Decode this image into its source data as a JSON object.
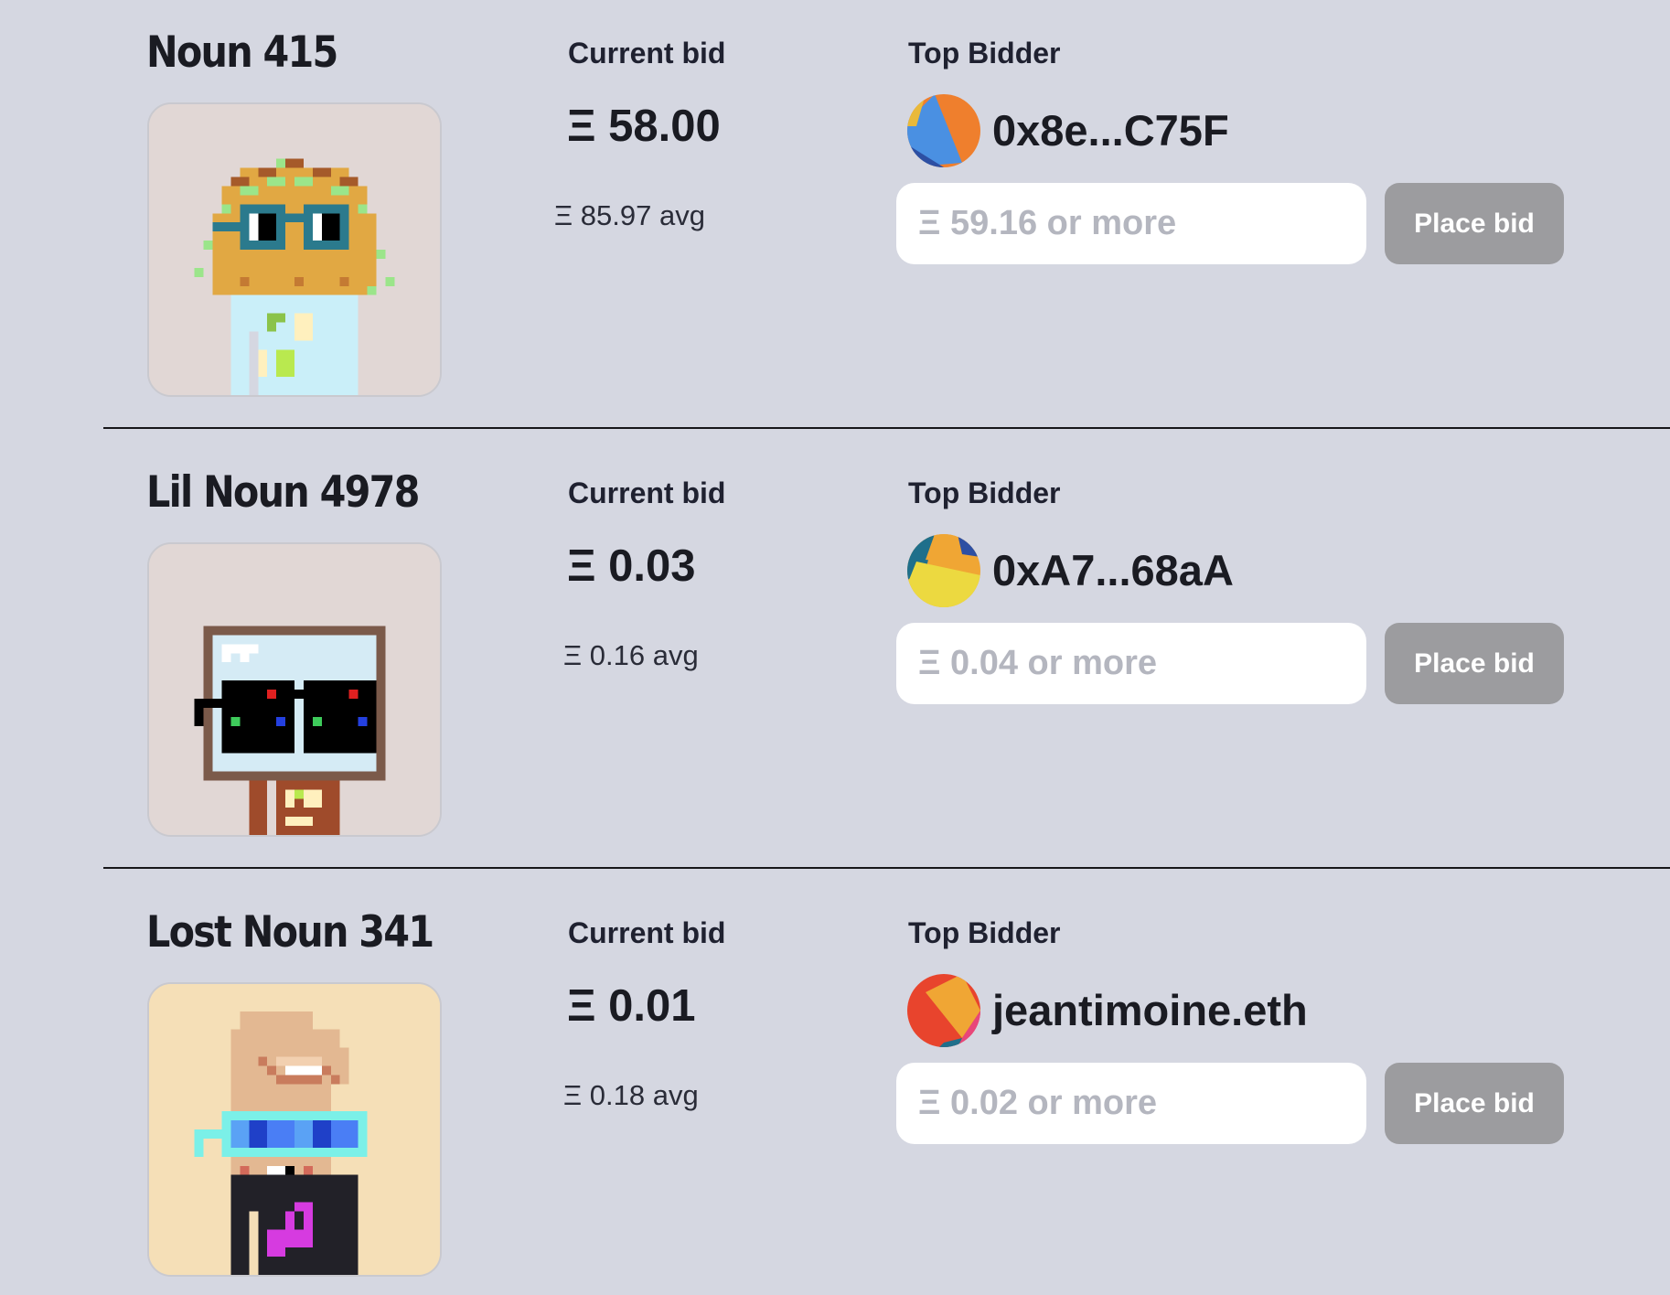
{
  "currency_symbol": "Ξ",
  "colors": {
    "page_background": "#d5d7e1",
    "divider": "#17171a",
    "input_background": "#ffffff",
    "button_background": "#9c9c9f",
    "button_text": "#ffffff",
    "placeholder_text": "#b4b6bf"
  },
  "auctions": [
    {
      "title": "Noun 415",
      "art_icon": "noun-415-pixel-art",
      "current_bid_label": "Current bid",
      "current_bid": "Ξ 58.00",
      "avg": "Ξ 85.97 avg",
      "top_bidder_label": "Top Bidder",
      "bidder_icon": "bidder-avatar-icon",
      "bidder": "0x8e...C75F",
      "input_placeholder": "Ξ 59.16 or more",
      "button_label": "Place bid"
    },
    {
      "title": "Lil Noun 4978",
      "art_icon": "lil-noun-4978-pixel-art",
      "current_bid_label": "Current bid",
      "current_bid": "Ξ 0.03",
      "avg": "Ξ 0.16 avg",
      "top_bidder_label": "Top Bidder",
      "bidder_icon": "bidder-avatar-icon",
      "bidder": "0xA7...68aA",
      "input_placeholder": "Ξ 0.04 or more",
      "button_label": "Place bid"
    },
    {
      "title": "Lost Noun 341",
      "art_icon": "lost-noun-341-pixel-art",
      "current_bid_label": "Current bid",
      "current_bid": "Ξ 0.01",
      "avg": "Ξ 0.18 avg",
      "top_bidder_label": "Top Bidder",
      "bidder_icon": "bidder-avatar-icon",
      "bidder": "jeantimoine.eth",
      "input_placeholder": "Ξ 0.02 or more",
      "button_label": "Place bid"
    }
  ]
}
